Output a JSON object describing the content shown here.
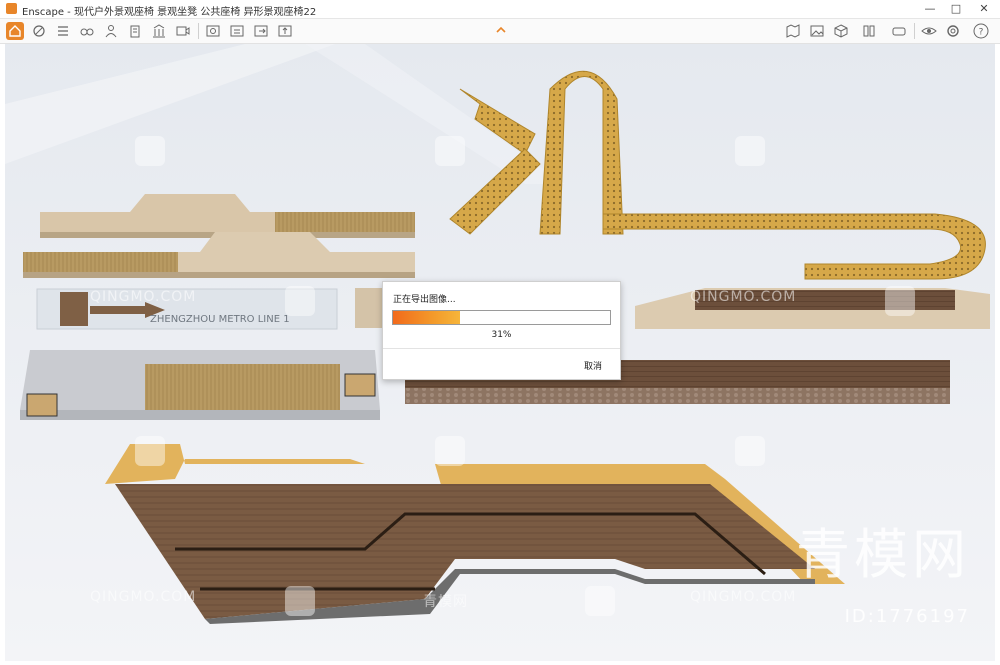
{
  "window": {
    "app_name": "Enscape",
    "title": "Enscape - 现代户外景观座椅 景观坐凳 公共座椅 异形景观座椅22",
    "controls": {
      "minimize": "—",
      "maximize": "□",
      "close": "✕"
    }
  },
  "toolbar": {
    "left_icons": [
      "home-icon",
      "asset-icon",
      "list-icon",
      "binoculars-icon",
      "person-icon",
      "building-icon",
      "library-icon",
      "video-icon",
      "screenshot-icon",
      "batch-icon",
      "export-icon",
      "upload-icon"
    ],
    "right_icons": [
      "map-icon",
      "image-icon",
      "cube-icon",
      "book-icon",
      "vr-icon",
      "eye-icon",
      "settings-icon",
      "help-icon"
    ],
    "help_label": "?"
  },
  "dialog": {
    "message": "正在导出图像...",
    "progress": 0.31,
    "percent_label": "31%",
    "cancel_label": "取消"
  },
  "scene": {
    "sign_text": "ZHENGZHOU METRO LINE 1",
    "watermarks": {
      "brand_big": "青模网",
      "id": "ID:1776197",
      "site": "QINGMO.COM",
      "site_cn": "青模网"
    }
  }
}
